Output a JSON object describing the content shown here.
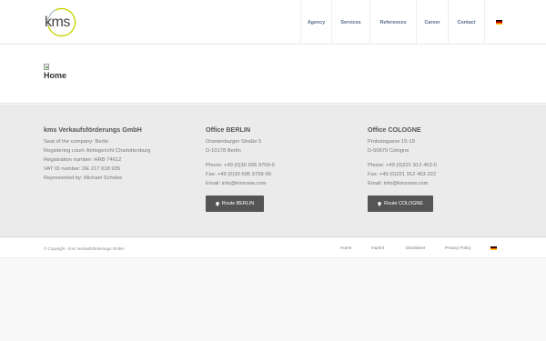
{
  "header": {
    "logo_text": "kms",
    "nav": [
      {
        "label": "Agency"
      },
      {
        "label": "Services"
      },
      {
        "label": "References"
      },
      {
        "label": "Career"
      },
      {
        "label": "Contact"
      }
    ],
    "language_flag_icon": "flag-de-icon"
  },
  "title_section": {
    "title": "Home"
  },
  "footer": {
    "company": {
      "title": "kms Verkaufsförderungs GmbH",
      "lines": [
        "Seat of the company: Berlin",
        "Registering court: Amtsgericht Charlottenburg",
        "Registration number: HRB 74612",
        "VAT ID number: DE 217 618 935",
        "Represented by: Michael Scholze"
      ]
    },
    "berlin": {
      "title": "Office BERLIN",
      "address": [
        "Oranienburger Straße 5",
        "D-10178 Berlin"
      ],
      "contact": [
        "Phone: +49 (0)30 695 9709-0",
        "Fax: +49 (0)30 695 9709-99",
        "Email: info@kmsnow.com"
      ],
      "button": "Route BERLIN"
    },
    "cologne": {
      "title": "Office COLOGNE",
      "address": [
        "Probstegasse 15-19",
        "D-50670 Cologne"
      ],
      "contact": [
        "Phone: +49 (0)221 912 463-0",
        "Fax: +49 (0)221 912 463-222",
        "Email: info@kmsnow.com"
      ],
      "button": "Route COLOGNE"
    }
  },
  "socket": {
    "copyright": "© Copyright - kms Verkaufsförderungs GmbH",
    "links": [
      "Home",
      "Imprint",
      "Disclaimer",
      "Privacy Policy"
    ]
  },
  "colors": {
    "logo_ring": "#c8d400",
    "nav_text": "#5a6d8f",
    "button_bg": "#555555",
    "footer_bg": "#ebebeb"
  }
}
